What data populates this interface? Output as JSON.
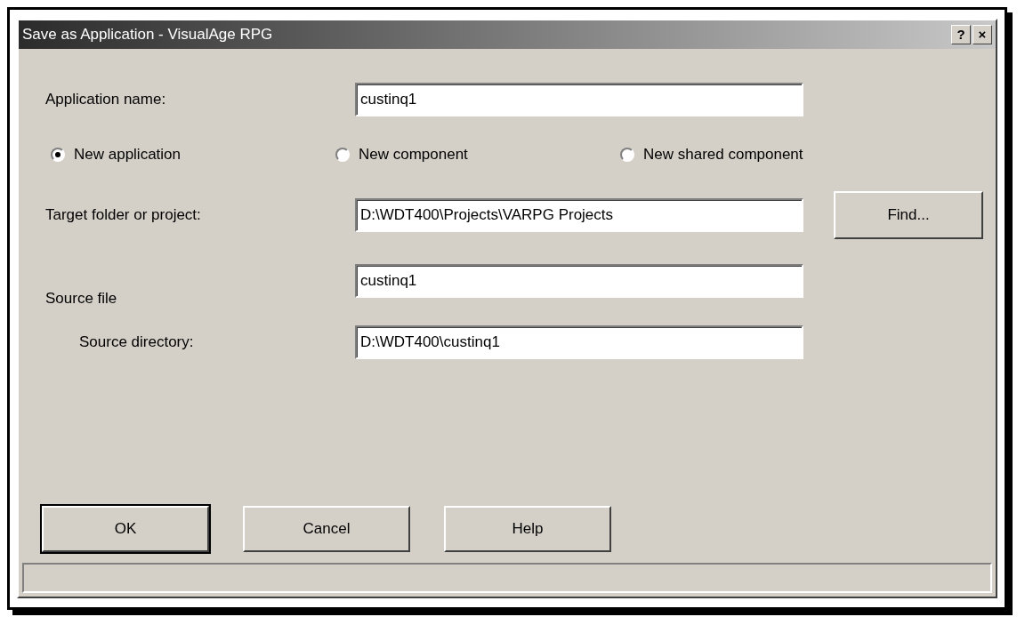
{
  "window": {
    "title": "Save as Application - VisualAge RPG",
    "title_buttons": [
      "?",
      "×"
    ]
  },
  "application_name": {
    "label": "Application name:",
    "value": "custinq1"
  },
  "type_options": [
    {
      "label": "New application",
      "selected": true
    },
    {
      "label": "New component",
      "selected": false
    },
    {
      "label": "New shared component",
      "selected": false
    }
  ],
  "target": {
    "label": "Target folder or project:",
    "value": "D:\\WDT400\\Projects\\VARPG Projects",
    "button": "Find..."
  },
  "source_file": {
    "label": "Source file",
    "value": "custinq1"
  },
  "source_directory": {
    "label": "Source directory:",
    "value": "D:\\WDT400\\custinq1"
  },
  "buttons": [
    {
      "label": "OK",
      "default": true
    },
    {
      "label": "Cancel",
      "default": false
    },
    {
      "label": "Help",
      "default": false
    }
  ]
}
